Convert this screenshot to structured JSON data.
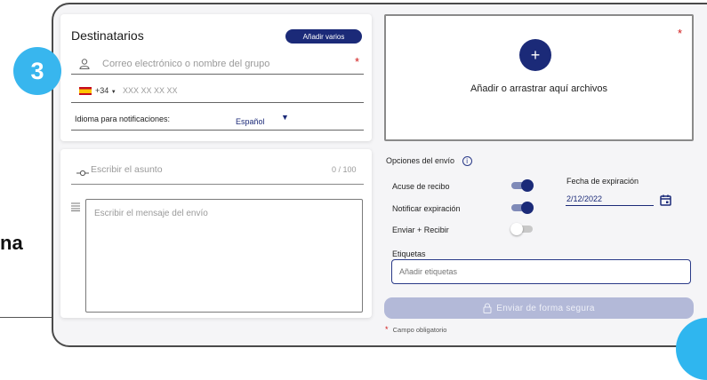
{
  "step": {
    "number": "3"
  },
  "background": {
    "partial_text": "na"
  },
  "recipients": {
    "title": "Destinatarios",
    "add_many_label": "Añadir varios",
    "email_placeholder": "Correo electrónico o nombre del grupo",
    "required_mark": "*",
    "phone_prefix": "+34",
    "phone_placeholder": "XXX XX XX XX",
    "language_label": "Idioma para notificaciones:",
    "language_value": "Español"
  },
  "message": {
    "subject_placeholder": "Escribir el asunto",
    "subject_counter": "0 / 100",
    "body_placeholder": "Escribir el mensaje del envío"
  },
  "dropzone": {
    "label": "Añadir o arrastrar aquí archivos",
    "add_symbol": "+",
    "required_mark": "*"
  },
  "options": {
    "title": "Opciones del envío",
    "info_symbol": "i",
    "toggles": [
      {
        "label": "Acuse de recibo",
        "state": "on"
      },
      {
        "label": "Notificar expiración",
        "state": "on"
      },
      {
        "label": "Enviar + Recibir",
        "state": "off"
      }
    ],
    "expiration_label": "Fecha de expiración",
    "expiration_value": "2/12/2022",
    "tags_label": "Etiquetas",
    "tags_placeholder": "Añadir etiquetas"
  },
  "send_button": {
    "label": "Enviar de forma segura"
  },
  "footer": {
    "required_mark": "*",
    "required_note": "Campo obligatorio"
  },
  "colors": {
    "accent": "#1b2a78",
    "badge": "#38b6ee",
    "required": "#d01818",
    "send_disabled": "#b3b9d8"
  }
}
